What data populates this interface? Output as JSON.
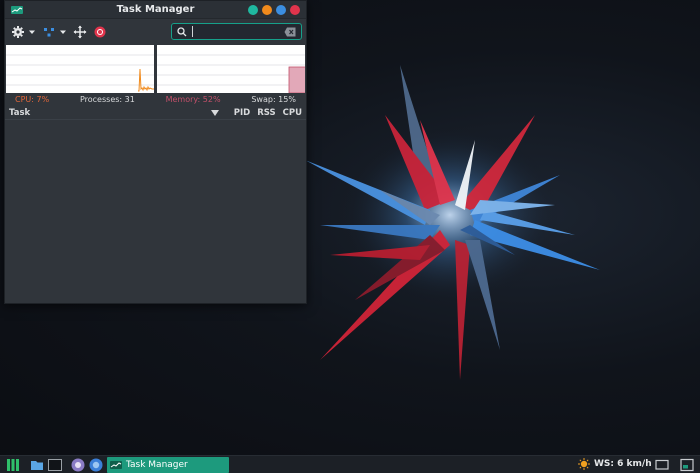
{
  "window": {
    "title": "Task Manager",
    "controls": [
      "minimize",
      "maximize",
      "restore",
      "close"
    ],
    "colors": {
      "min": "#1fb8a0",
      "max": "#f08a1c",
      "restore": "#3b8ee0",
      "close": "#e0344c"
    }
  },
  "toolbar": {
    "items": [
      "gear-icon",
      "tree-view-icon",
      "move-icon",
      "stop-icon"
    ]
  },
  "search": {
    "value": "",
    "placeholder": ""
  },
  "stats": {
    "cpu": "CPU: 7%",
    "processes": "Processes: 31",
    "memory": "Memory: 52%",
    "swap": "Swap: 15%"
  },
  "columns": {
    "task": "Task",
    "pid": "PID",
    "rss": "RSS",
    "cpu": "CPU"
  },
  "taskbar": {
    "task_button_label": "Task Manager",
    "weather": "WS: 6 km/h"
  },
  "colors": {
    "accent": "#1d9a7d",
    "cpu_graph": "#f08a1c",
    "mem_graph": "#d8a0b0"
  }
}
